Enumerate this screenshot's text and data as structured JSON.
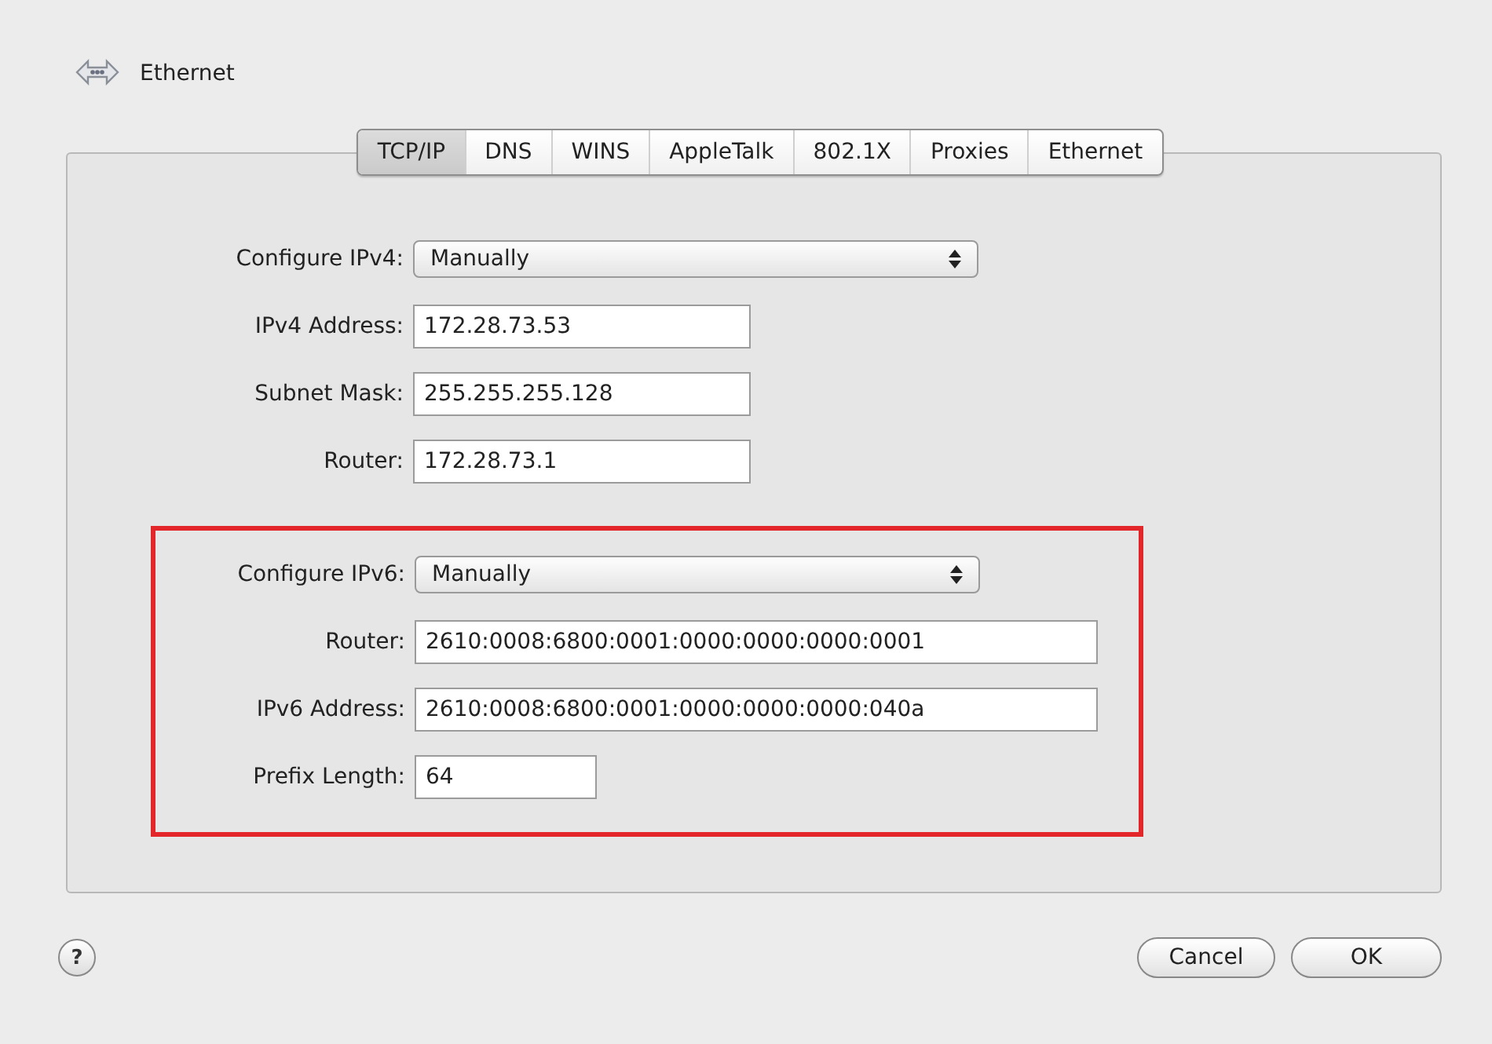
{
  "header": {
    "title": "Ethernet"
  },
  "tabs": [
    {
      "label": "TCP/IP",
      "selected": true
    },
    {
      "label": "DNS",
      "selected": false
    },
    {
      "label": "WINS",
      "selected": false
    },
    {
      "label": "AppleTalk",
      "selected": false
    },
    {
      "label": "802.1X",
      "selected": false
    },
    {
      "label": "Proxies",
      "selected": false
    },
    {
      "label": "Ethernet",
      "selected": false
    }
  ],
  "ipv4": [
    {
      "kind": "popup",
      "label": "Configure IPv4:",
      "value": "Manually"
    },
    {
      "kind": "field",
      "label": "IPv4 Address:",
      "value": "172.28.73.53"
    },
    {
      "kind": "field",
      "label": "Subnet Mask:",
      "value": "255.255.255.128"
    },
    {
      "kind": "field",
      "label": "Router:",
      "value": "172.28.73.1"
    }
  ],
  "ipv6": [
    {
      "kind": "popup",
      "label": "Configure IPv6:",
      "value": "Manually"
    },
    {
      "kind": "wide_field",
      "label": "Router:",
      "value": "2610:0008:6800:0001:0000:0000:0000:0001"
    },
    {
      "kind": "wide_field",
      "label": "IPv6 Address:",
      "value": "2610:0008:6800:0001:0000:0000:0000:040a"
    },
    {
      "kind": "narrow_field",
      "label": "Prefix Length:",
      "value": "64"
    }
  ],
  "help": {
    "label": "?"
  },
  "buttons": [
    {
      "label": "Cancel"
    },
    {
      "label": "OK"
    }
  ]
}
